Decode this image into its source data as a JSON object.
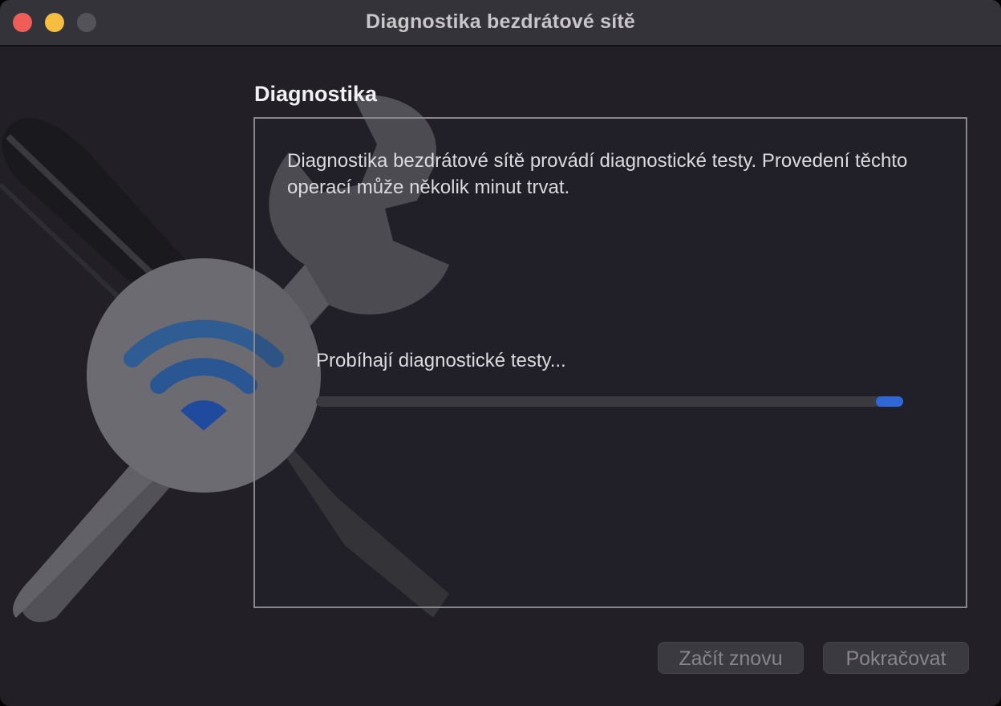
{
  "window": {
    "title": "Diagnostika bezdrátové sítě"
  },
  "main": {
    "heading": "Diagnostika",
    "description": "Diagnostika bezdrátové sítě provádí diagnostické testy. Provedení těchto operací může několik minut trvat.",
    "status_text": "Probíhají diagnostické testy...",
    "progress": 0.96
  },
  "buttons": {
    "restart_label": "Začít znovu",
    "continue_label": "Pokračovat"
  },
  "icons": {
    "illustration": "wireless-diagnostics-icon",
    "wifi": "wifi-icon"
  },
  "colors": {
    "accent": "#2f67d6",
    "close": "#ee5e56",
    "minimize": "#f5be41"
  }
}
